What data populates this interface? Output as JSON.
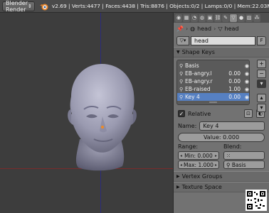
{
  "topbar": {
    "render_engine": "Blender Render",
    "stats": "v2.69 | Verts:4477 | Faces:4438 | Tris:8876 | Objects:0/2 | Lamps:0/0 | Mem:22.03M ("
  },
  "context": {
    "object": "head",
    "mesh": "head"
  },
  "mesh": {
    "name": "head",
    "fake_user": "F"
  },
  "shape_keys": {
    "title": "Shape Keys",
    "items": [
      {
        "name": "Basis",
        "value": ""
      },
      {
        "name": "EB-angry.l",
        "value": "0.00"
      },
      {
        "name": "EB-angry.r",
        "value": "0.00"
      },
      {
        "name": "EB-raised",
        "value": "1.00"
      },
      {
        "name": "Key 4",
        "value": "0.00"
      }
    ],
    "selected_index": 4
  },
  "relative": {
    "label": "Relative"
  },
  "name_field": {
    "label": "Name:",
    "value": "Key 4"
  },
  "value_field": {
    "label": "Value: 0.000"
  },
  "range": {
    "label": "Range:",
    "min": "Min: 0.000",
    "max": "Max: 1.000"
  },
  "blend": {
    "label": "Blend:",
    "vertex_group": "",
    "relative_key": "Basis"
  },
  "panels": {
    "vertex_groups": "Vertex Groups",
    "texture_space": "Texture Space"
  },
  "colors": {
    "selection": "#5680c2",
    "panel_bg": "#727272",
    "viewport_bg": "#3d3d3d"
  }
}
